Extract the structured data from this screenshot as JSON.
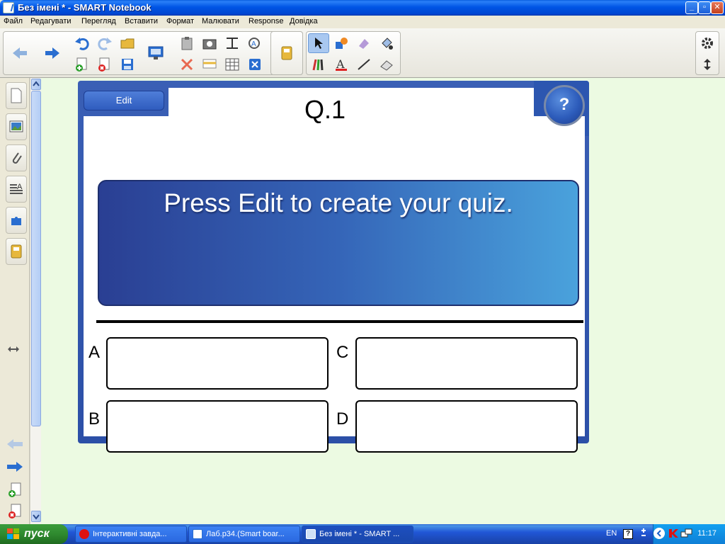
{
  "window": {
    "title": "Без імені * - SMART Notebook",
    "minimize": "_",
    "maximize": "▫",
    "close": "✕"
  },
  "menu": [
    "Файл",
    "Редагувати",
    "Перегляд",
    "Вставити",
    "Формат",
    "Малювати",
    "Response",
    "Довідка"
  ],
  "quiz": {
    "edit_label": "Edit",
    "help_label": "?",
    "title": "Q.1",
    "question": "Press Edit to create your quiz.",
    "options": [
      {
        "letter": "A"
      },
      {
        "letter": "B"
      },
      {
        "letter": "C"
      },
      {
        "letter": "D"
      }
    ]
  },
  "taskbar": {
    "start_label": "пуск",
    "tasks": [
      {
        "label": "Інтерактивні завда...",
        "icon": "opera-icon"
      },
      {
        "label": "Лаб.р34.(Smart boar...",
        "icon": "word-icon"
      },
      {
        "label": "Без імені * - SMART ...",
        "icon": "smart-notebook-icon"
      }
    ],
    "lang": "EN",
    "clock": "11:17"
  },
  "colors": {
    "canvas_bg": "#ecfae2",
    "quiz_frame": "#2c4fa7",
    "question_gradient_start": "#2a3f93",
    "question_gradient_end": "#4aa2dc"
  }
}
